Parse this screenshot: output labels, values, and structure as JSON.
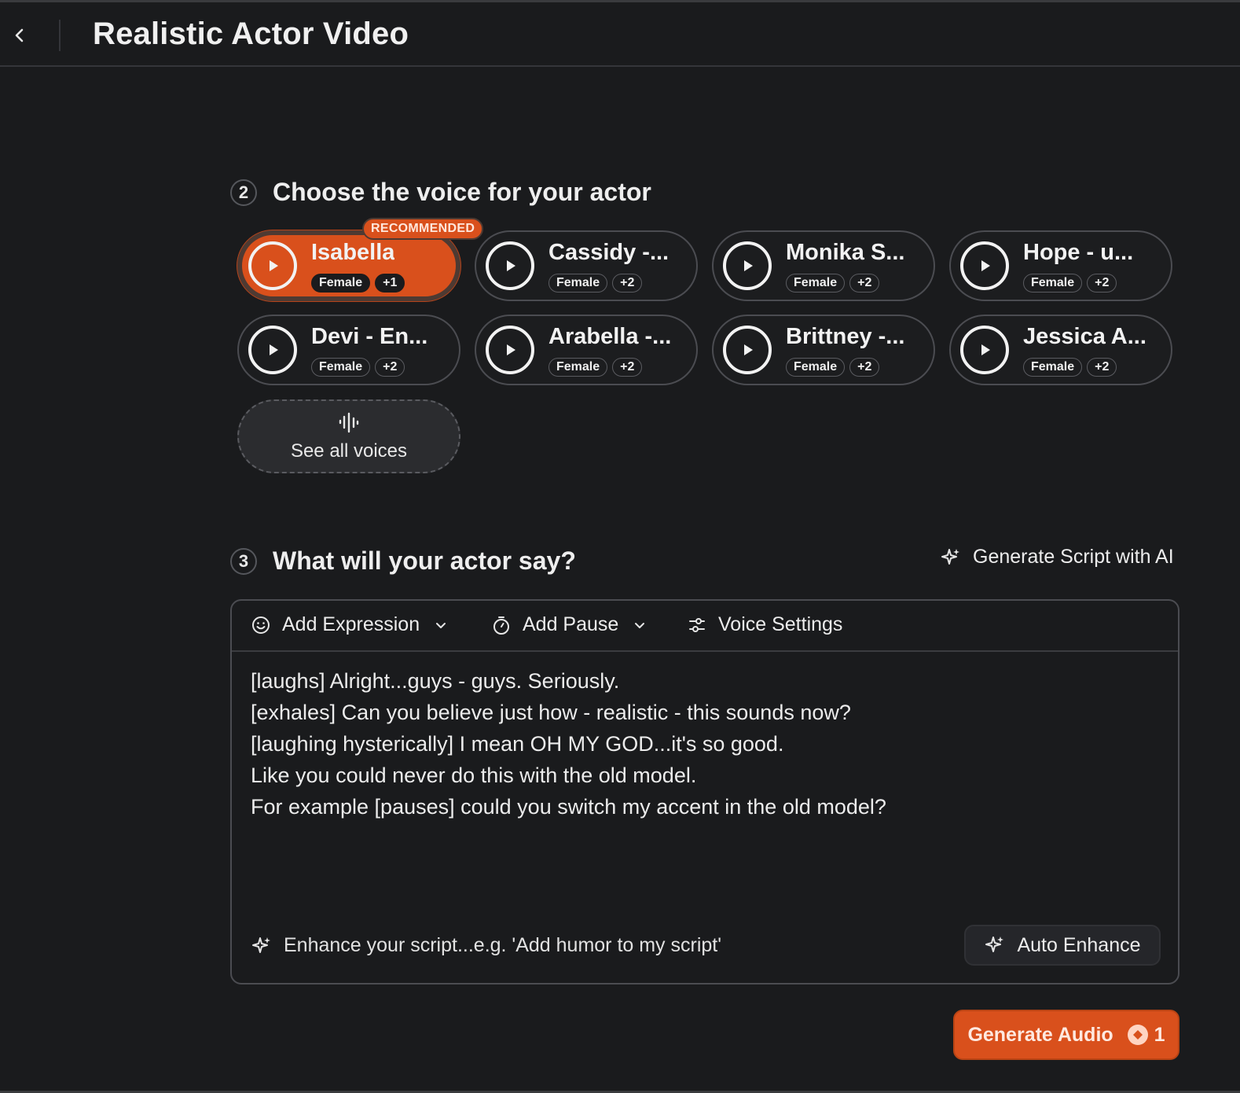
{
  "header": {
    "title": "Realistic Actor Video"
  },
  "voice_section": {
    "step_number": "2",
    "title": "Choose the voice for your actor",
    "recommended_badge": "RECOMMENDED",
    "voices": [
      {
        "name": "Isabella",
        "tags": [
          "Female",
          "+1"
        ],
        "selected": true
      },
      {
        "name": "Cassidy -...",
        "tags": [
          "Female",
          "+2"
        ]
      },
      {
        "name": "Monika S...",
        "tags": [
          "Female",
          "+2"
        ]
      },
      {
        "name": "Hope - u...",
        "tags": [
          "Female",
          "+2"
        ]
      },
      {
        "name": "Devi - En...",
        "tags": [
          "Female",
          "+2"
        ]
      },
      {
        "name": "Arabella -...",
        "tags": [
          "Female",
          "+2"
        ]
      },
      {
        "name": "Brittney -...",
        "tags": [
          "Female",
          "+2"
        ]
      },
      {
        "name": "Jessica A...",
        "tags": [
          "Female",
          "+2"
        ]
      }
    ],
    "see_all_label": "See all voices"
  },
  "script_section": {
    "step_number": "3",
    "title": "What will your actor say?",
    "generate_ai_label": "Generate Script with AI",
    "toolbar": {
      "add_expression": "Add Expression",
      "add_pause": "Add Pause",
      "voice_settings": "Voice Settings"
    },
    "script_lines": [
      "[laughs] Alright...guys - guys. Seriously.",
      "[exhales] Can you believe just how - realistic - this sounds now?",
      "[laughing hysterically] I mean OH MY GOD...it's so good.",
      "Like you could never do this with the old model.",
      "For example [pauses] could you switch my accent in the old model?"
    ],
    "enhance_placeholder": "Enhance your script...e.g. 'Add humor to my script'",
    "auto_enhance_label": "Auto Enhance"
  },
  "generate": {
    "label": "Generate Audio",
    "credits": "1"
  },
  "colors": {
    "accent": "#d9501c",
    "background": "#1a1b1d",
    "border": "#4b4c51"
  }
}
